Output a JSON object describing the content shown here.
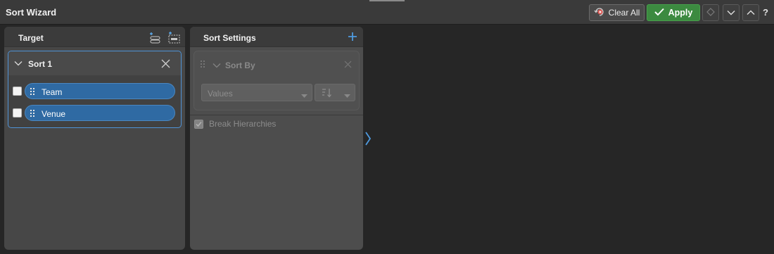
{
  "window": {
    "title": "Sort Wizard"
  },
  "toolbar": {
    "clear_label": "Clear All",
    "apply_label": "Apply",
    "help_label": "?"
  },
  "colors": {
    "accent": "#4f93d6",
    "apply": "#3c8a40",
    "pill": "#2f6aa3"
  },
  "target": {
    "title": "Target",
    "sorts": [
      {
        "name": "Sort 1",
        "fields": [
          {
            "label": "Team"
          },
          {
            "label": "Venue"
          }
        ]
      }
    ]
  },
  "settings": {
    "title": "Sort Settings",
    "sort_by_label": "Sort By",
    "values_select": "Values",
    "break_hierarchies_label": "Break Hierarchies"
  },
  "icons": [
    "clear-icon",
    "check-icon",
    "diamond-icon",
    "chevron-down-icon",
    "chevron-up-icon",
    "add-sort-icon",
    "add-group-icon",
    "close-icon",
    "grip-icon",
    "plus-icon",
    "sort-direction-icon",
    "expand-right-icon"
  ]
}
